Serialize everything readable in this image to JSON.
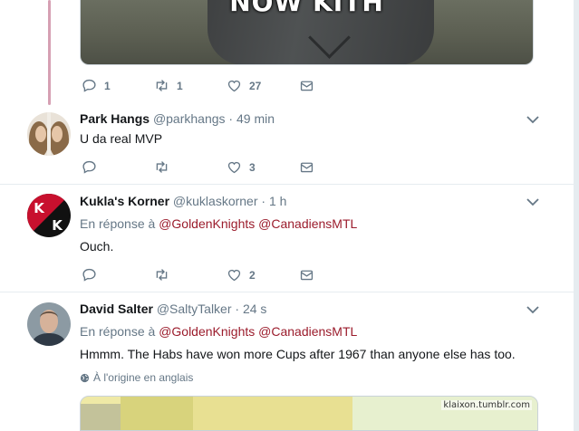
{
  "top_tweet": {
    "media_caption": "NOW KITH",
    "counts": {
      "reply": "1",
      "retweet": "1",
      "like": "27"
    }
  },
  "tweets": [
    {
      "name": "Park Hangs",
      "handle": "@parkhangs",
      "time": "49 min",
      "text": "U da real MVP",
      "counts": {
        "reply": "",
        "retweet": "",
        "like": "3"
      }
    },
    {
      "name": "Kukla's Korner",
      "handle": "@kuklaskorner",
      "time": "1 h",
      "reply_prefix": "En réponse à",
      "mentions": [
        "@GoldenKnights",
        "@CanadiensMTL"
      ],
      "text": "Ouch.",
      "counts": {
        "reply": "",
        "retweet": "",
        "like": "2"
      }
    },
    {
      "name": "David Salter",
      "handle": "@SaltyTalker",
      "time": "24 s",
      "reply_prefix": "En réponse à",
      "mentions": [
        "@GoldenKnights",
        "@CanadiensMTL"
      ],
      "text": "Hmmm. The Habs have won more Cups after 1967 than anyone else has too.",
      "translate_label": "À l'origine en anglais",
      "media_watermark": "klaixon.tumblr.com"
    }
  ],
  "colors": {
    "accent_link": "#9b1c2c",
    "secondary_text": "#657786",
    "thread_line": "#d6a0b3"
  }
}
